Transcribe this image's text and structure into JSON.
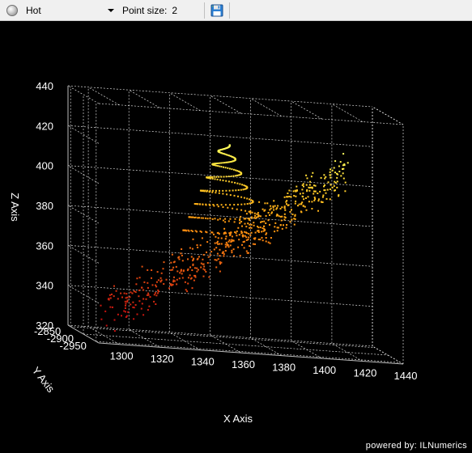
{
  "toolbar": {
    "colormap_value": "Hot",
    "colormap_icon": "colormap-icon",
    "point_size_label": "Point size:",
    "point_size_value": "2",
    "save_icon": "save-icon"
  },
  "footer": {
    "powered_by": "powered by: ILNumerics"
  },
  "colors": {
    "background": "#000000",
    "grid": "#ffffff",
    "hot_low": "#cc1010",
    "hot_mid": "#ff8c00",
    "hot_high": "#ffff40"
  },
  "chart_data": {
    "type": "scatter",
    "subtype": "3d-scatter",
    "colormap": "Hot",
    "grid": true,
    "xlabel": "X Axis",
    "ylabel": "Y Axis",
    "zlabel": "Z Axis",
    "xlim": [
      1290,
      1440
    ],
    "ylim": [
      -2960,
      -2840
    ],
    "zlim": [
      320,
      440
    ],
    "x_ticks": [
      "1300",
      "1320",
      "1340",
      "1360",
      "1380",
      "1400",
      "1420",
      "1440"
    ],
    "y_ticks": [
      "-2950",
      "-2900",
      "-2850"
    ],
    "z_ticks": [
      "320",
      "340",
      "360",
      "380",
      "400",
      "420",
      "440"
    ],
    "components": [
      {
        "kind": "band",
        "x_range": [
          1300,
          1420
        ],
        "z_range": [
          328,
          410
        ],
        "z_spread": 8,
        "y_spread": 40,
        "count": 520
      },
      {
        "kind": "spiral",
        "center_x": 1360,
        "z_range": [
          372,
          420
        ],
        "radius_range": [
          22,
          2
        ],
        "turns": 7,
        "count": 300
      }
    ]
  }
}
